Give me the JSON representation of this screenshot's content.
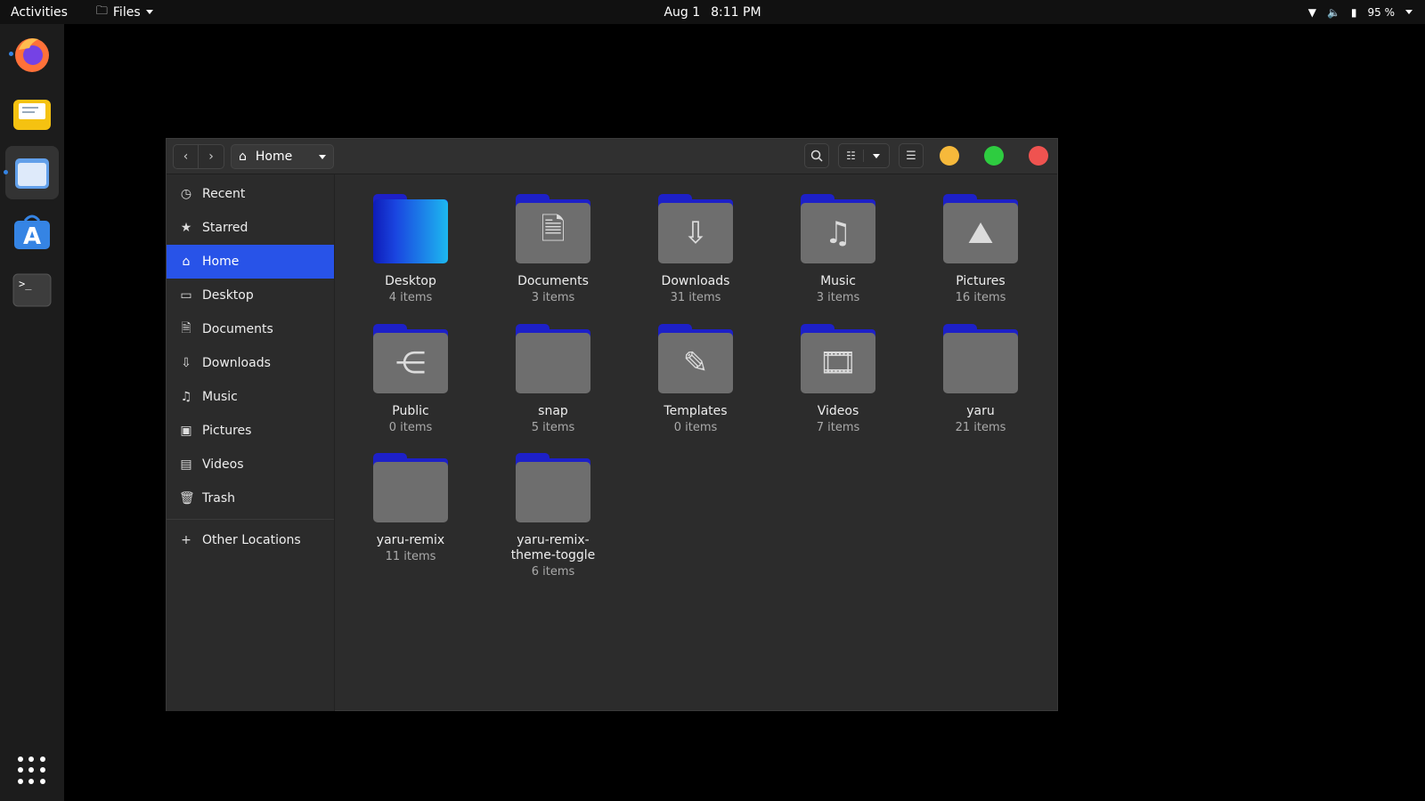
{
  "topbar": {
    "activities": "Activities",
    "app_menu": "Files",
    "date": "Aug 1",
    "time": "8:11 PM",
    "battery": "95 %"
  },
  "dock": {
    "apps": [
      {
        "name": "firefox-icon",
        "color": "#ff7139"
      },
      {
        "name": "mail-icon",
        "color": "#f5c211"
      },
      {
        "name": "files-icon",
        "color": "#62a0ea"
      },
      {
        "name": "software-icon",
        "color": "#3584e4"
      },
      {
        "name": "terminal-icon",
        "color": "#3d3d3d"
      }
    ]
  },
  "window": {
    "path": "Home",
    "controls": {
      "minimize": "#f6b93b",
      "maximize": "#2ecc40",
      "close": "#ef5350"
    }
  },
  "sidebar": {
    "items": [
      {
        "label": "Recent",
        "icon": "clock-icon"
      },
      {
        "label": "Starred",
        "icon": "star-icon"
      },
      {
        "label": "Home",
        "icon": "home-icon"
      },
      {
        "label": "Desktop",
        "icon": "desktop-icon"
      },
      {
        "label": "Documents",
        "icon": "document-icon"
      },
      {
        "label": "Downloads",
        "icon": "download-icon"
      },
      {
        "label": "Music",
        "icon": "music-icon"
      },
      {
        "label": "Pictures",
        "icon": "picture-icon"
      },
      {
        "label": "Videos",
        "icon": "video-icon"
      },
      {
        "label": "Trash",
        "icon": "trash-icon"
      }
    ],
    "other": "Other Locations"
  },
  "files": [
    {
      "name": "Desktop",
      "count": "4 items",
      "glyph": ""
    },
    {
      "name": "Documents",
      "count": "3 items",
      "glyph": "🗎"
    },
    {
      "name": "Downloads",
      "count": "31 items",
      "glyph": "⇩"
    },
    {
      "name": "Music",
      "count": "3 items",
      "glyph": "♫"
    },
    {
      "name": "Pictures",
      "count": "16 items",
      "glyph": "⛰"
    },
    {
      "name": "Public",
      "count": "0 items",
      "glyph": "⋲"
    },
    {
      "name": "snap",
      "count": "5 items",
      "glyph": ""
    },
    {
      "name": "Templates",
      "count": "0 items",
      "glyph": "✎"
    },
    {
      "name": "Videos",
      "count": "7 items",
      "glyph": "🎞"
    },
    {
      "name": "yaru",
      "count": "21 items",
      "glyph": ""
    },
    {
      "name": "yaru-remix",
      "count": "11 items",
      "glyph": ""
    },
    {
      "name": "yaru-remix-theme-toggle",
      "count": "6 items",
      "glyph": ""
    }
  ]
}
